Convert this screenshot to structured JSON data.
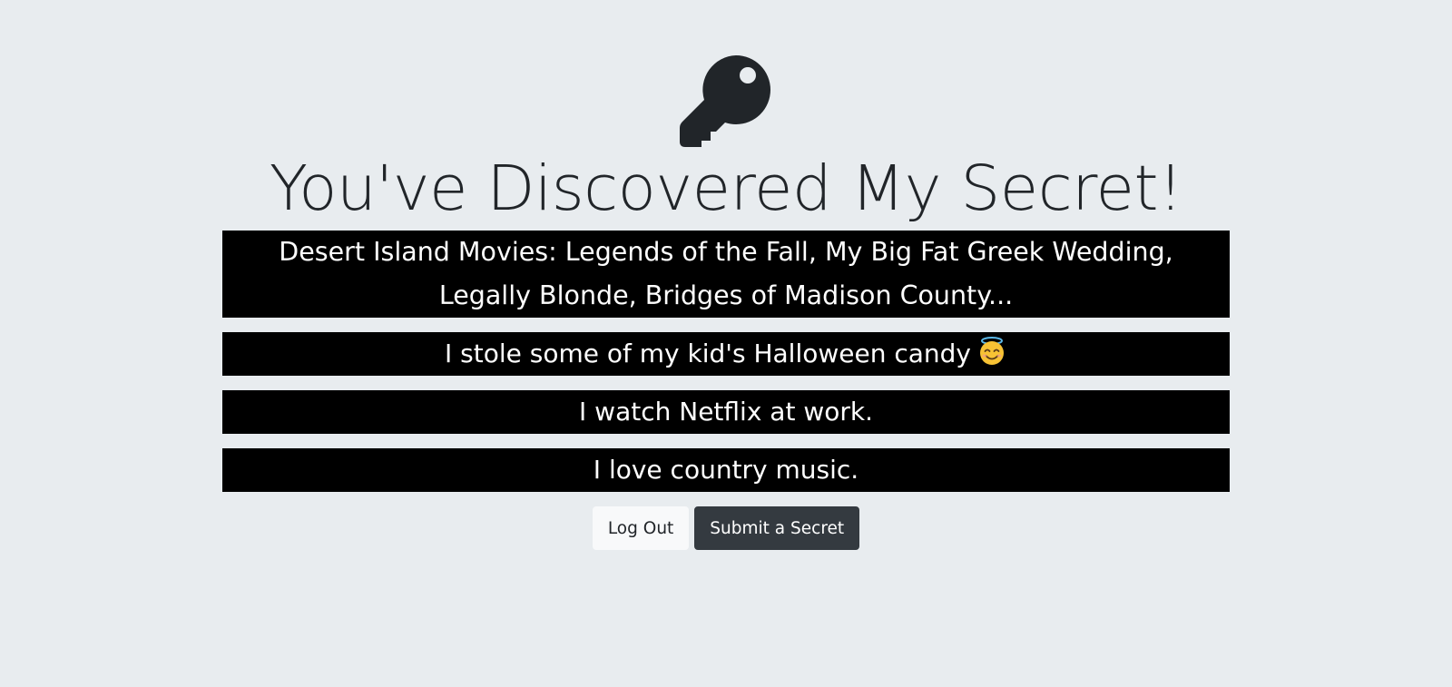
{
  "header": {
    "icon": "key-icon",
    "title": "You've Discovered My Secret!"
  },
  "secrets": [
    {
      "text": "Desert Island Movies: Legends of the Fall, My Big Fat Greek Wedding, Legally Blonde, Bridges of Madison County..."
    },
    {
      "text": "I stole some of my kid's Halloween candy",
      "emoji": "smiling-face-with-halo-icon"
    },
    {
      "text": "I watch Netflix at work."
    },
    {
      "text": "I love country music."
    }
  ],
  "actions": {
    "logout_label": "Log Out",
    "submit_label": "Submit a Secret"
  },
  "colors": {
    "background": "#e8ecef",
    "secret_background": "#000000",
    "secret_text": "#ffffff",
    "dark_button": "#343a40",
    "light_button": "#f8f9fa",
    "title_text": "#212529"
  }
}
